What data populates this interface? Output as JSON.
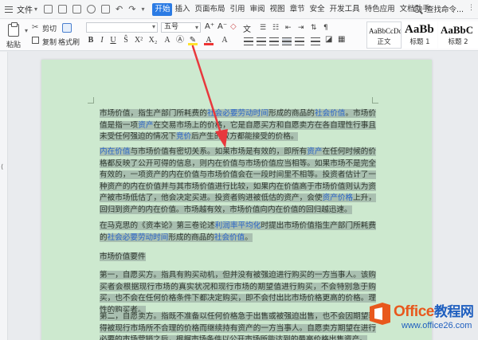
{
  "menubar": {
    "file_label": "文件",
    "tabs": [
      "开始",
      "插入",
      "页面布局",
      "引用",
      "审阅",
      "视图",
      "章节",
      "安全",
      "开发工具",
      "特色应用",
      "文档助手"
    ],
    "search_label": "查找命令..."
  },
  "ribbon": {
    "paste_label": "粘贴",
    "cut_label": "剪切",
    "copy_label": "复制",
    "format_painter_label": "格式刷",
    "font_name": "",
    "font_size": "五号",
    "styles": [
      {
        "preview": "AaBbCcDd",
        "name": "正文"
      },
      {
        "preview": "AaBb",
        "name": "标题 1"
      },
      {
        "preview": "AaBbC",
        "name": "标题 2"
      }
    ]
  },
  "document": {
    "p1_a": "市场价值，指生产部门所耗费的",
    "p1_link1": "社会必要劳动时间",
    "p1_b": "形成的商品的",
    "p1_link2": "社会价值",
    "p1_c": "。市场价值是指一项",
    "p1_link3": "资产",
    "p1_d": "在交易市场上的价格，它是自愿买方和自愿卖方在各自理性行事且未受任何强迫的情况下",
    "p1_link4": "竞价",
    "p1_e": "后产生的双方都能接受的价格。",
    "p2_link1": "内在价值",
    "p2_a": "与市场价值有密切关系。如果市场是有效的，即所有",
    "p2_link2": "资产",
    "p2_b": "在任何时候的价格都反映了公开可得的信息，则内在价值与市场价值应当相等。如果市场不是完全有效的，一项资产的内在价值与市场价值会在一段时间里不相等。投资者估计了一种资产的内在价值并与其市场价值进行比较，如果内在价值高于市场价值则认为资产被市场低估了，他会决定买进。投资者购进被低估的资产，会使",
    "p2_link3": "资产价格",
    "p2_c": "上升，回归到资产的内在价值。市场越有效，市场价值向内在价值的回归越迅速。",
    "p3_a": "在马克思的《资本论》第三卷论述",
    "p3_link1": "利润率平均化",
    "p3_b": "时提出市场价值指生产部门所耗费的",
    "p3_link2": "社会必要劳动时间",
    "p3_c": "形成的商品的",
    "p3_link3": "社会价值",
    "p3_d": "。",
    "p4": "市场价值要件",
    "p5": "第一，自愿买方。指具有购买动机，但并没有被强迫进行购买的一方当事人。该购买者会根据现行市场的真实状况和现行市场的期望值进行购买，不会特别急于购买，也不会在任何价格条件下都决定购买，即不会付出比市场价格更高的价格。理性的购买者。",
    "p6": "第二，自愿卖方。指既不准备以任何价格急于出售或被强迫出售，也不会因期望获得被现行市场所不合理的价格而继续持有资产的一方当事人。自愿卖方期望在进行必要的市场营销之后，根据市场条件以公开市场所能达到的最高价格出售资产。"
  },
  "watermark": {
    "title_latin": "Office",
    "title_cn": "教程网",
    "url": "www.office26.com"
  },
  "colors": {
    "page_background": "#cde9cf",
    "selection": "#a9bfb0",
    "link": "#2a66c9",
    "arrow": "#e8383d",
    "tab_active": "#2b7be4"
  }
}
